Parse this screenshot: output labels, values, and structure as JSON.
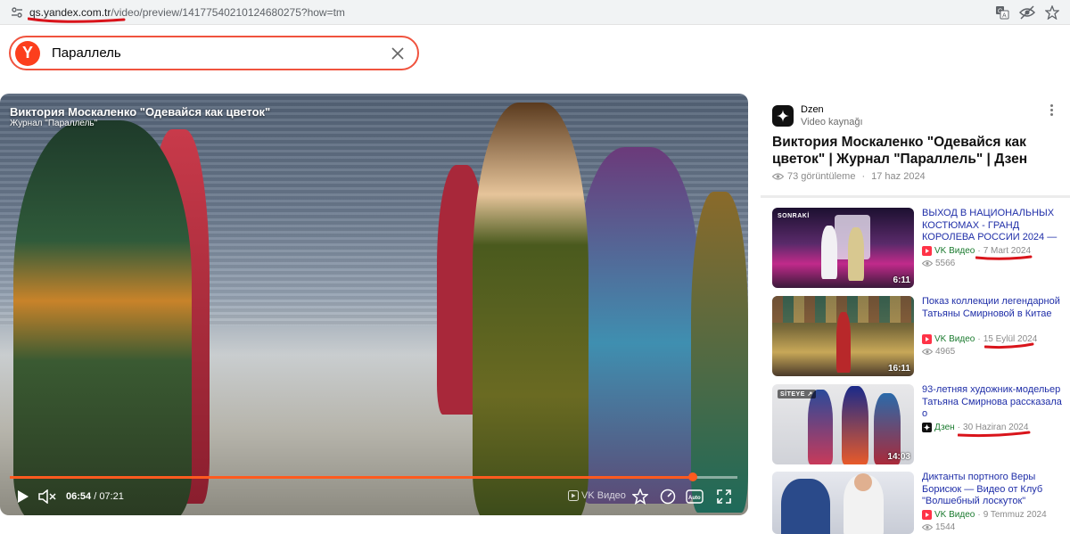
{
  "address_bar": {
    "host": "qs.yandex.com.tr",
    "path": "/video/preview/14177540210124680275?how=tm"
  },
  "search": {
    "value": "Параллель",
    "logo": "Y"
  },
  "player": {
    "title": "Виктория Москаленко \"Одевайся как цветок\"",
    "subtitle": "Журнал \"Параллель\"",
    "current_time": "06:54",
    "separator": " / ",
    "duration": "07:21",
    "progress": 0.939,
    "brand": "VK Видео",
    "auto_label": "Auto"
  },
  "source": {
    "name": "Dzen",
    "type": "Video kaynağı"
  },
  "main_video": {
    "title": "Виктория Москаленко \"Одевайся как цветок\" | Журнал \"Параллель\" | Дзен",
    "views": "73 görüntüleme",
    "dot": "·",
    "date": "17 haz 2024"
  },
  "recommendations": [
    {
      "title": "ВЫХОД В НАЦИОНАЛЬНЫХ КОСТЮМАХ - ГРАНД КОРОЛЕВА РОССИИ 2024 —",
      "source": "VK Видео",
      "date": "7 Mart 2024",
      "views": "5566",
      "duration": "6:11",
      "tag": "SONRAKİ"
    },
    {
      "title": "Показ коллекции легендарной Татьяны Смирновой в Китае",
      "source": "VK Видео",
      "date": "15 Eylül 2024",
      "views": "4965",
      "duration": "16:11",
      "tag": ""
    },
    {
      "title": "93-летняя художник-модельер Татьяна Смирнова рассказала о",
      "source": "Дзен",
      "date": "30 Haziran 2024",
      "views": "",
      "duration": "14:03",
      "tag": "SİTEYE ↗"
    },
    {
      "title": "Диктанты портного Веры Борисюк — Видео от Клуб \"Волшебный лоскуток\"",
      "source": "VK Видео",
      "date": "9 Temmuz 2024",
      "views": "1544",
      "duration": "",
      "tag": ""
    }
  ],
  "colors": {
    "accent": "#ff5a1f",
    "link": "#1f2ea8",
    "annotation_red": "#d9141b",
    "vk_red": "#ff3347"
  }
}
